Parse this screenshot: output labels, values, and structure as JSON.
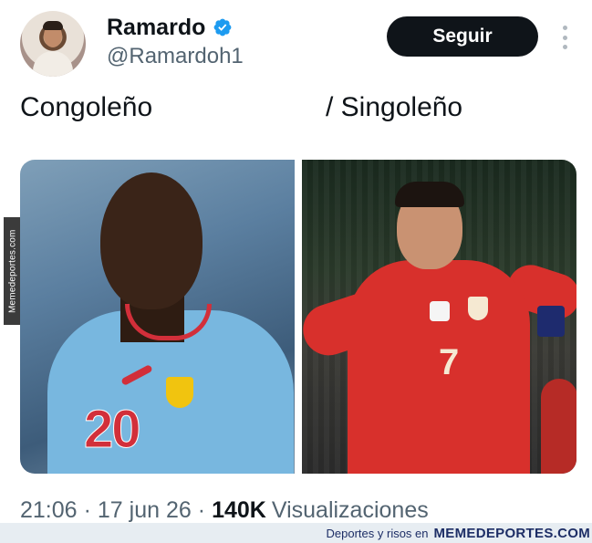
{
  "tweet": {
    "author": {
      "display_name": "Ramardo",
      "handle": "@Ramardoh1",
      "verified": true,
      "verified_color": "#1d9bf0"
    },
    "follow_label": "Seguir",
    "more_icon": "more-vertical-icon",
    "caption_left": "Congoleño",
    "caption_right": "/ Singoleño",
    "meta": {
      "time": "21:06",
      "date": "17 jun 26",
      "views_count": "140K",
      "views_label": "Visualizaciones",
      "separator": "·"
    }
  },
  "watermark": {
    "side": "Memedeportes.com",
    "footer_prefix": "Deportes y risos en",
    "footer_brand": "MEMEDEPORTES.COM"
  },
  "images": {
    "left": {
      "jersey_number": "20"
    },
    "right": {
      "jersey_number": "7"
    }
  },
  "colors": {
    "follow_button_bg": "#0f1419",
    "text_primary": "#0f1419",
    "text_secondary": "#536471"
  }
}
